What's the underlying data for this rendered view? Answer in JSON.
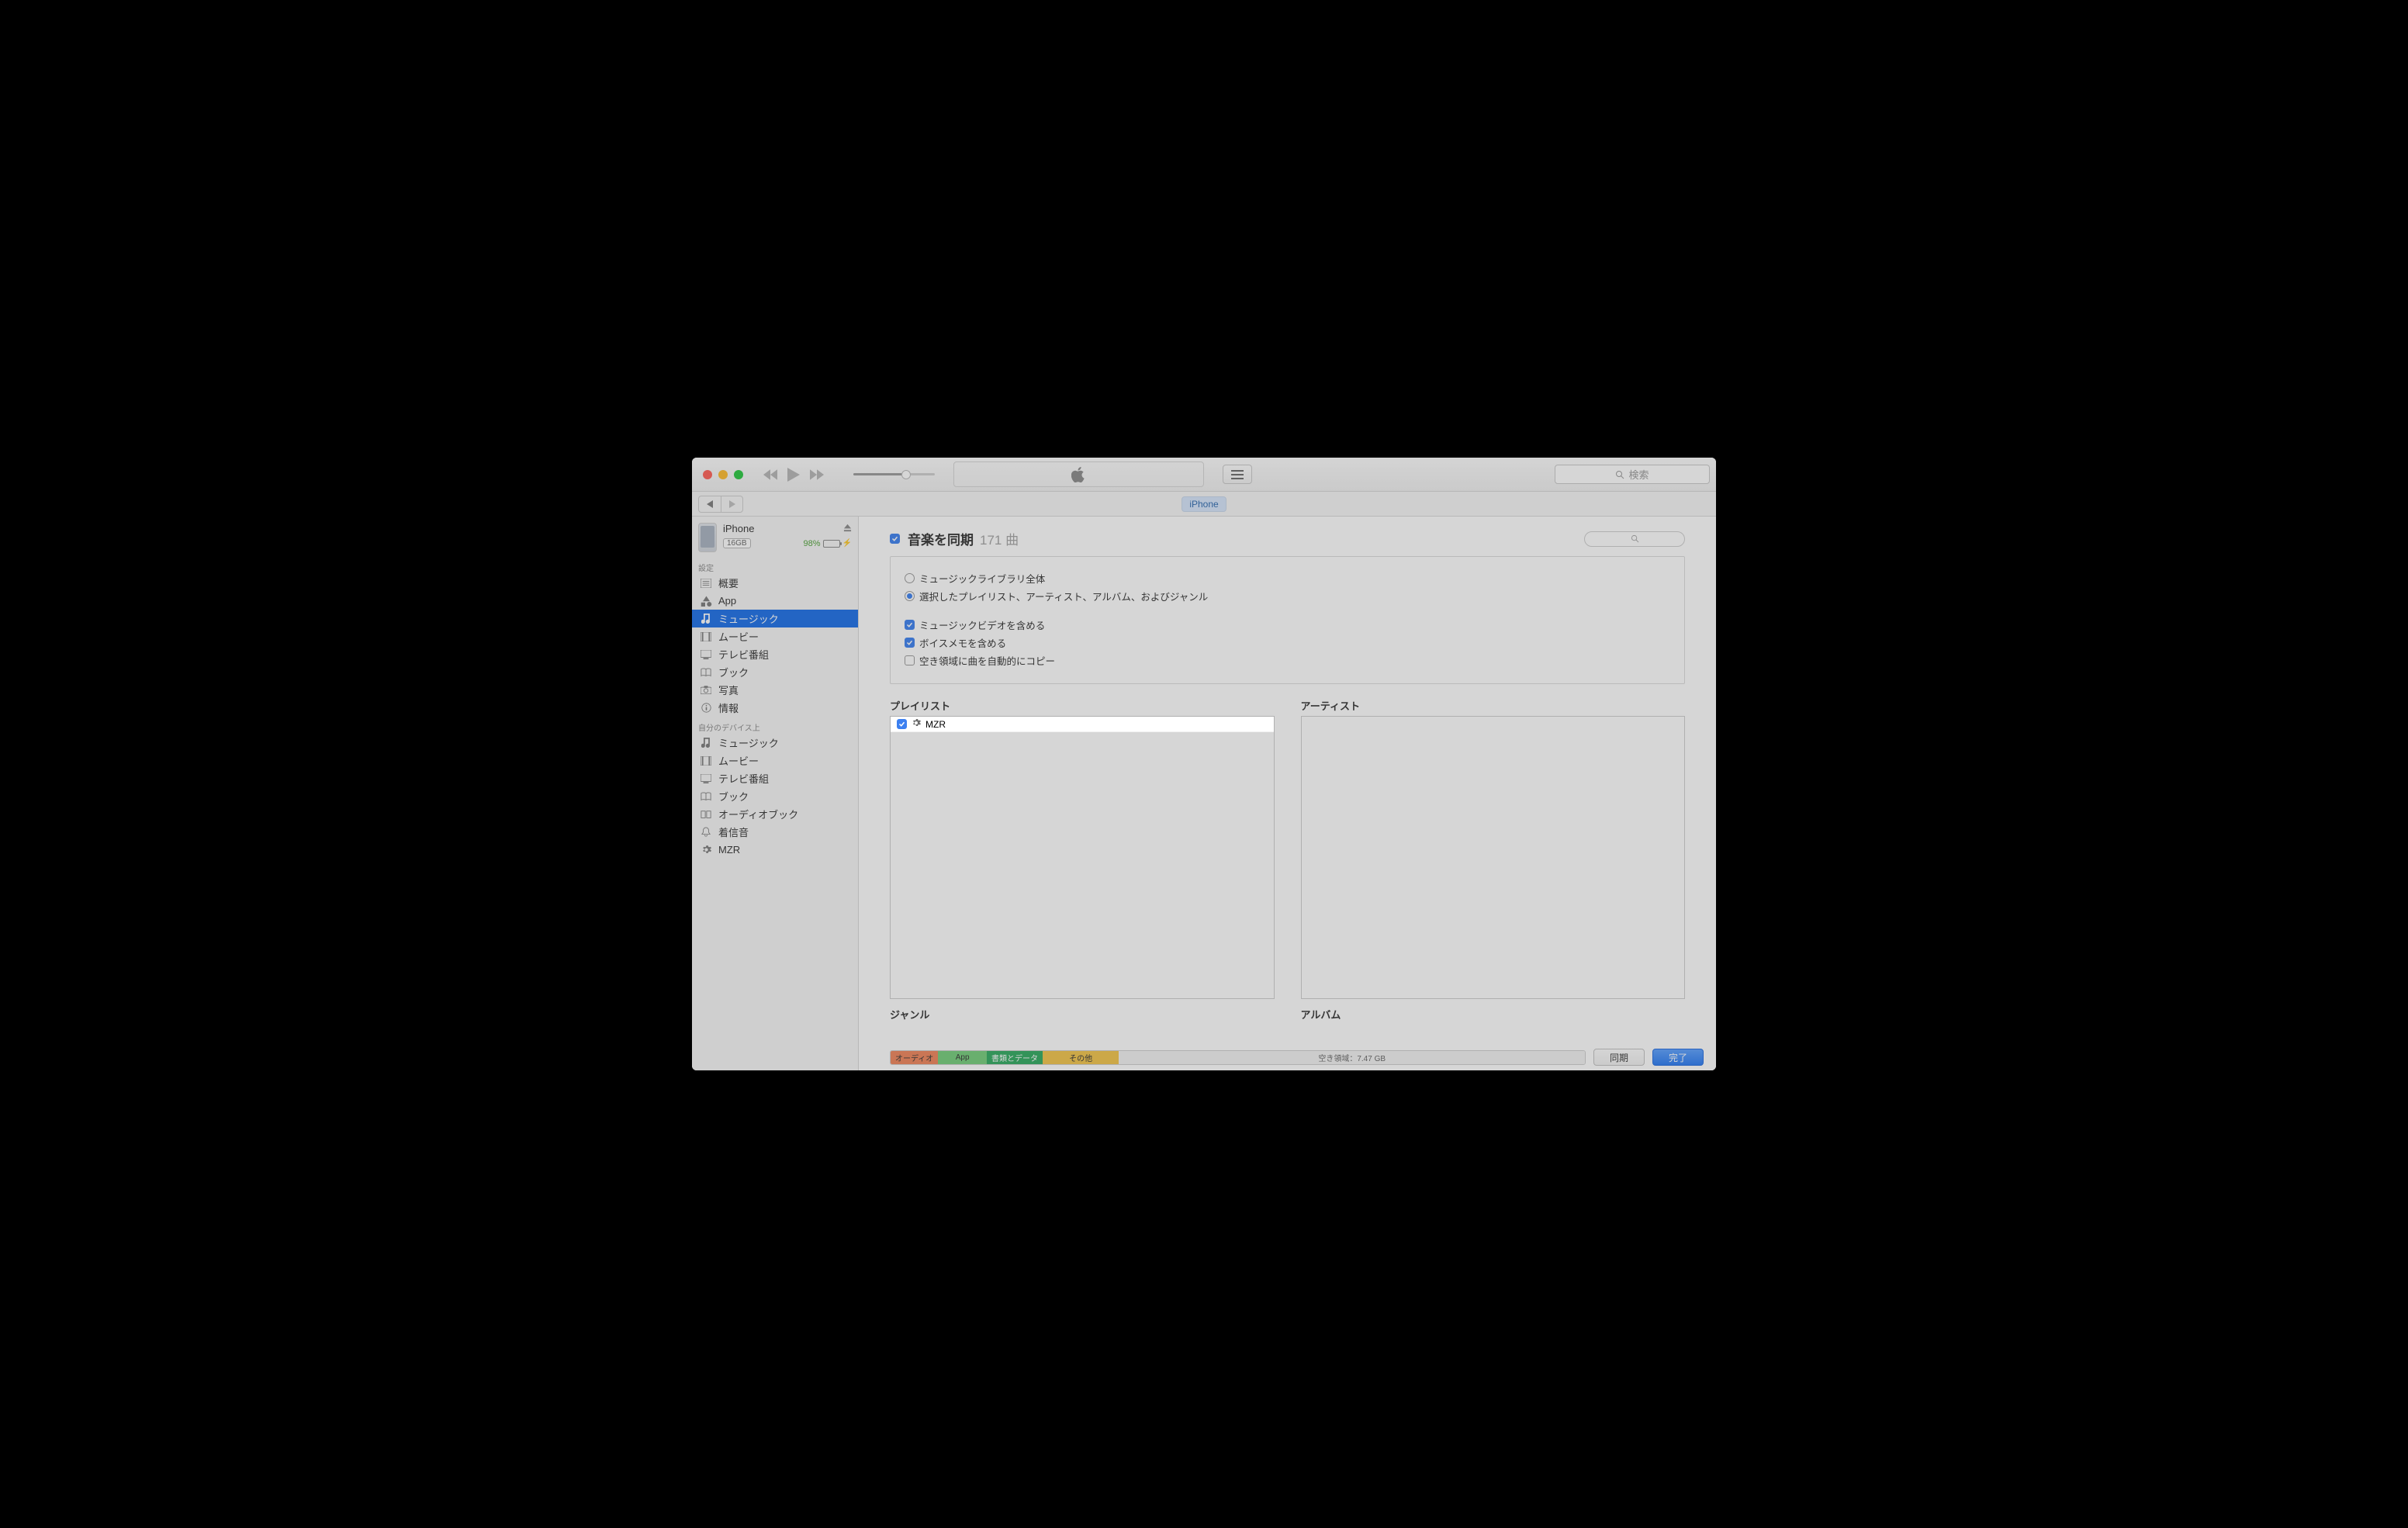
{
  "toolbar": {
    "search_placeholder": "検索",
    "device_chip": "iPhone"
  },
  "sidebar": {
    "device": {
      "name": "iPhone",
      "storage": "16GB",
      "battery_pct": "98%"
    },
    "group_settings": {
      "header": "設定",
      "items": [
        "概要",
        "App",
        "ミュージック",
        "ムービー",
        "テレビ番組",
        "ブック",
        "写真",
        "情報"
      ]
    },
    "group_device": {
      "header": "自分のデバイス上",
      "items": [
        "ミュージック",
        "ムービー",
        "テレビ番組",
        "ブック",
        "オーディオブック",
        "着信音",
        "MZR"
      ]
    }
  },
  "main": {
    "sync_title": "音楽を同期",
    "sync_count": "171 曲",
    "radio": {
      "all": "ミュージックライブラリ全体",
      "selected": "選択したプレイリスト、アーティスト、アルバム、およびジャンル"
    },
    "options": {
      "include_mv": "ミュージックビデオを含める",
      "include_voice": "ボイスメモを含める",
      "autofill": "空き領域に曲を自動的にコピー"
    },
    "panels": {
      "playlists": "プレイリスト",
      "artists": "アーティスト",
      "genres": "ジャンル",
      "albums": "アルバム"
    },
    "playlist_items": [
      {
        "name": "MZR",
        "checked": true
      }
    ]
  },
  "footer": {
    "capacity": {
      "audio": "オーディオ",
      "app": "App",
      "docs": "書類とデータ",
      "other": "その他",
      "free": "空き領域：7.47 GB"
    },
    "sync_btn": "同期",
    "done_btn": "完了"
  }
}
